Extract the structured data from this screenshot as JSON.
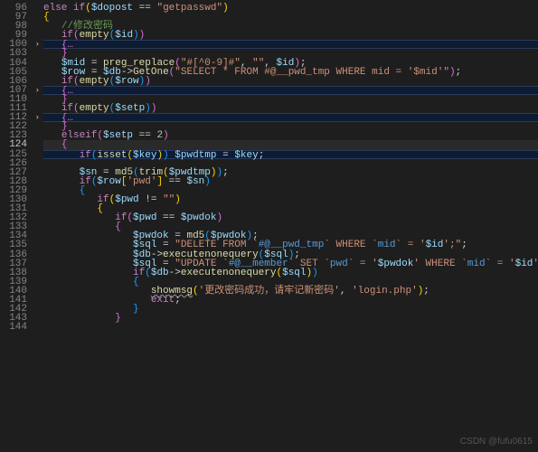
{
  "gutter": {
    "start": 96,
    "skips": [
      101,
      102,
      108,
      109,
      113,
      114,
      115,
      116,
      117,
      118,
      119,
      120,
      121
    ],
    "current": 124,
    "folds": [
      100,
      107,
      112
    ]
  },
  "lines": {
    "l96": {
      "kw1": "else",
      "kw2": "if",
      "var": "$dopost",
      "str": "\"getpasswd\""
    },
    "l98": {
      "comment": "//修改密码"
    },
    "l99": {
      "kw": "if",
      "fn": "empty",
      "var": "$id"
    },
    "l100": {
      "txt": "{…"
    },
    "l103": {
      "txt": "}"
    },
    "l104": {
      "var1": "$mid",
      "fn": "preg_replace",
      "str1": "\"#[^0-9]#\"",
      "str2": "\"\"",
      "var2": "$id"
    },
    "l105": {
      "var1": "$row",
      "var2": "$db",
      "fn": "GetOne",
      "str": "\"SELECT * FROM #@__pwd_tmp WHERE mid = '$mid'\""
    },
    "l106": {
      "kw": "if",
      "fn": "empty",
      "var": "$row"
    },
    "l107": {
      "txt": "{…"
    },
    "l110": {
      "txt": "}"
    },
    "l111": {
      "kw": "if",
      "fn": "empty",
      "var": "$setp"
    },
    "l112": {
      "txt": "{…"
    },
    "l122": {
      "txt": "}"
    },
    "l123": {
      "kw": "elseif",
      "var": "$setp",
      "num": "2"
    },
    "l124": {
      "txt": "{"
    },
    "l125": {
      "kw": "if",
      "fn": "isset",
      "var1": "$key",
      "var2": "$pwdtmp",
      "var3": "$key"
    },
    "l127": {
      "var1": "$sn",
      "fn1": "md5",
      "fn2": "trim",
      "var2": "$pwdtmp"
    },
    "l128": {
      "kw": "if",
      "var1": "$row",
      "idx": "'pwd'",
      "var2": "$sn"
    },
    "l130": {
      "kw": "if",
      "var": "$pwd",
      "str": "\"\""
    },
    "l132": {
      "kw": "if",
      "var1": "$pwd",
      "var2": "$pwdok"
    },
    "l134": {
      "var1": "$pwdok",
      "fn": "md5",
      "var2": "$pwdok"
    },
    "l135": {
      "var": "$sql",
      "s1": "\"DELETE FROM `",
      "s2": "#@__pwd_tmp",
      "s3": "` WHERE `",
      "s4": "mid",
      "s5": "` = '",
      "v": "$id",
      "s6": "';\""
    },
    "l136": {
      "var": "$db",
      "fn": "executenonequery",
      "arg": "$sql"
    },
    "l137": {
      "var": "$sql",
      "s1": "\"UPDATE `",
      "s2": "#@__member",
      "s3": "` SET `",
      "s4": "pwd",
      "s5": "` = '",
      "v1": "$pwdok",
      "s6": "' WHERE `",
      "s7": "mid",
      "s8": "` = '",
      "v2": "$id",
      "s9": "';\""
    },
    "l138": {
      "kw": "if",
      "var": "$db",
      "fn": "executenonequery",
      "arg": "$sql"
    },
    "l140": {
      "fn": "showmsg",
      "str1": "'更改密码成功，请牢记新密码'",
      "str2": "'login.php'"
    },
    "l141": {
      "kw": "exit"
    }
  },
  "watermark": "CSDN @fufu0615"
}
